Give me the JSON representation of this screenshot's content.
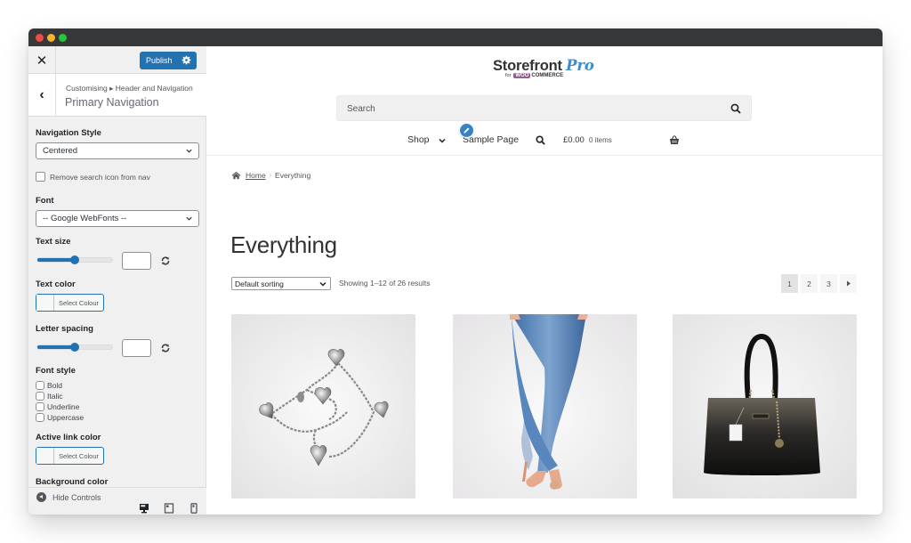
{
  "window": {
    "controls": [
      "close",
      "minimize",
      "maximize"
    ]
  },
  "sidebar": {
    "close_icon": "close-icon",
    "publish_label": "Publish",
    "publish_settings_icon": "gear-icon",
    "back_icon": "chevron-left-icon",
    "breadcrumb": "Customising ▸ Header and Navigation",
    "section_title": "Primary Navigation",
    "controls": {
      "navigation_style": {
        "label": "Navigation Style",
        "value": "Centered"
      },
      "remove_search": {
        "label": "Remove search icon from nav",
        "checked": false
      },
      "font": {
        "label": "Font",
        "value": "-- Google WebFonts --"
      },
      "text_size": {
        "label": "Text size",
        "slider_fraction": 0.5,
        "value": ""
      },
      "text_color": {
        "label": "Text color",
        "button_label": "Select Colour"
      },
      "letter_spacing": {
        "label": "Letter spacing",
        "slider_fraction": 0.5,
        "value": ""
      },
      "font_style": {
        "label": "Font style",
        "options": [
          {
            "label": "Bold",
            "checked": false
          },
          {
            "label": "Italic",
            "checked": false
          },
          {
            "label": "Underline",
            "checked": false
          },
          {
            "label": "Uppercase",
            "checked": false
          }
        ]
      },
      "active_link_color": {
        "label": "Active link color",
        "button_label": "Select Colour"
      },
      "background_color": {
        "label": "Background color"
      }
    },
    "footer": {
      "hide_controls_label": "Hide Controls",
      "devices": [
        "desktop-icon",
        "tablet-icon",
        "mobile-icon"
      ],
      "active_device": "desktop"
    }
  },
  "preview": {
    "logo": {
      "word": "Storefront",
      "pro": "Pro",
      "for": "for",
      "woo": "WOO",
      "commerce": "COMMERCE"
    },
    "search": {
      "placeholder": "Search"
    },
    "nav": {
      "items": [
        {
          "label": "Shop",
          "has_dropdown": true
        },
        {
          "label": "Sample Page"
        }
      ],
      "cart_price": "£0.00",
      "cart_items": "0 items"
    },
    "breadcrumb": {
      "home": "Home",
      "separator": "›",
      "current": "Everything"
    },
    "page_title": "Everything",
    "sorting": {
      "value": "Default sorting"
    },
    "result_count": "Showing 1–12 of 26 results",
    "pagination": {
      "pages": [
        "1",
        "2",
        "3"
      ],
      "current": "1",
      "next_icon": "next-arrow-icon"
    },
    "products": [
      {
        "image": "silver-heart-charm-bracelet"
      },
      {
        "image": "blue-skinny-jeans"
      },
      {
        "image": "black-leather-handbag"
      }
    ]
  },
  "colors": {
    "accent": "#2271b1",
    "titlebar": "#363739",
    "sidebar_bg": "#f0f0f1",
    "logo_pro": "#3c8ccf",
    "woo_purple": "#9b5c8f"
  }
}
